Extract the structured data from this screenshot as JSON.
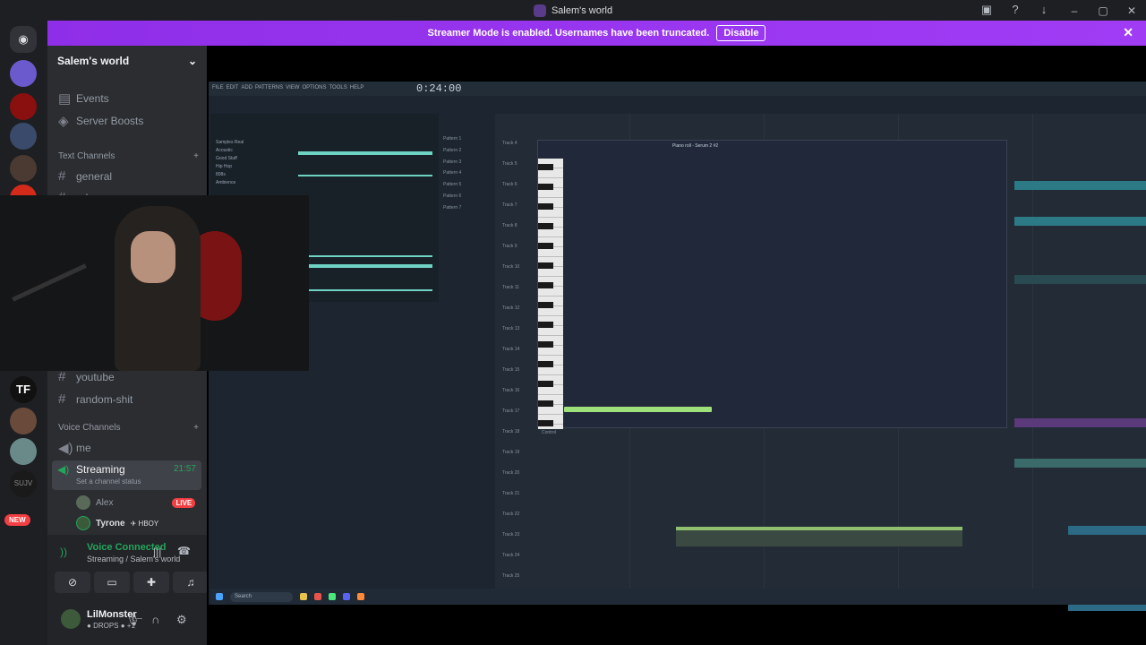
{
  "window": {
    "title": "Salem's world"
  },
  "banner": {
    "text": "Streamer Mode is enabled. Usernames have been truncated.",
    "disable_label": "Disable"
  },
  "guilds": {
    "new_badge": "NEW"
  },
  "server": {
    "name": "Salem's world"
  },
  "nav": {
    "events": "Events",
    "boosts": "Server Boosts"
  },
  "text_channels": {
    "header": "Text Channels",
    "items": [
      "general",
      "rules",
      "youtube",
      "random-shit"
    ]
  },
  "voice_channels": {
    "header": "Voice Channels",
    "me": "me",
    "streaming": {
      "name": "Streaming",
      "time": "21:57",
      "status": "Set a channel status"
    },
    "users": [
      {
        "name": "Alex",
        "badge": "LIVE"
      },
      {
        "name": "Tyrone",
        "tag": "HBOY"
      }
    ]
  },
  "voice_panel": {
    "title": "Voice Connected",
    "subtitle": "Streaming / Salem's world"
  },
  "user": {
    "name": "LilMonster_",
    "status": "DROPS",
    "extra": "+1"
  },
  "stream": {
    "time": "0:24:00",
    "menu": [
      "FILE",
      "EDIT",
      "ADD",
      "PATTERNS",
      "VIEW",
      "OPTIONS",
      "TOOLS",
      "HELP"
    ],
    "browser_items": [
      "Samples Real",
      "Acoustic",
      "Good Stuff",
      "Hip Hop",
      "808s",
      "Ambience"
    ],
    "patterns": [
      "Pattern 1",
      "Pattern 2",
      "Pattern 3",
      "Pattern 4",
      "Pattern 5",
      "Pattern 6",
      "Pattern 7"
    ],
    "tracks": [
      "Track 4",
      "Track 5",
      "Track 6",
      "Track 7",
      "Track 8",
      "Track 9",
      "Track 10",
      "Track 11",
      "Track 12",
      "Track 13",
      "Track 14",
      "Track 15",
      "Track 16",
      "Track 17",
      "Track 18",
      "Track 19",
      "Track 20",
      "Track 21",
      "Track 22",
      "Track 23",
      "Track 24",
      "Track 25"
    ],
    "piano_title": "Piano roll - Serum 2 #2",
    "control_label": "Control",
    "search_label": "Search"
  },
  "colors": {
    "accent": "#9b30ff",
    "online": "#23a55a",
    "live": "#f23f43"
  }
}
